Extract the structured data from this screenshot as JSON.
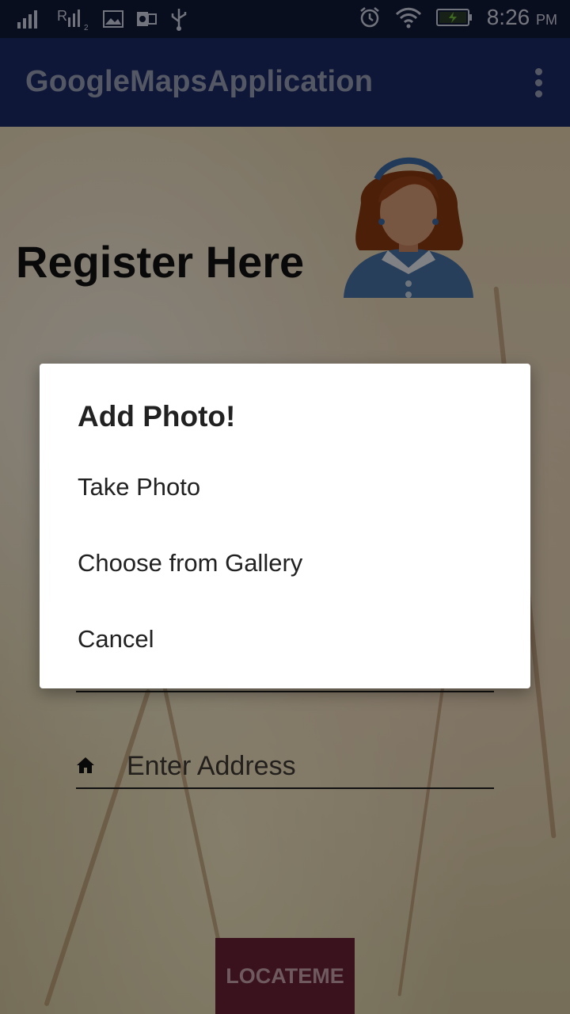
{
  "status_bar": {
    "time": "8:26",
    "ampm": "PM",
    "icons": [
      "signal-icon",
      "signal-2-icon",
      "image-icon",
      "outlook-icon",
      "usb-icon",
      "alarm-icon",
      "wifi-icon",
      "battery-charging-icon"
    ]
  },
  "app_bar": {
    "title": "GoogleMapsApplication",
    "menu_icon": "overflow-menu-icon"
  },
  "page": {
    "title": "Register Here",
    "avatar_icon": "female-avatar-icon",
    "address_placeholder": "Enter Address",
    "address_icon": "home-icon",
    "locate_button": "LOCATEME"
  },
  "dialog": {
    "title": "Add Photo!",
    "options": [
      "Take Photo",
      "Choose from Gallery",
      "Cancel"
    ]
  }
}
